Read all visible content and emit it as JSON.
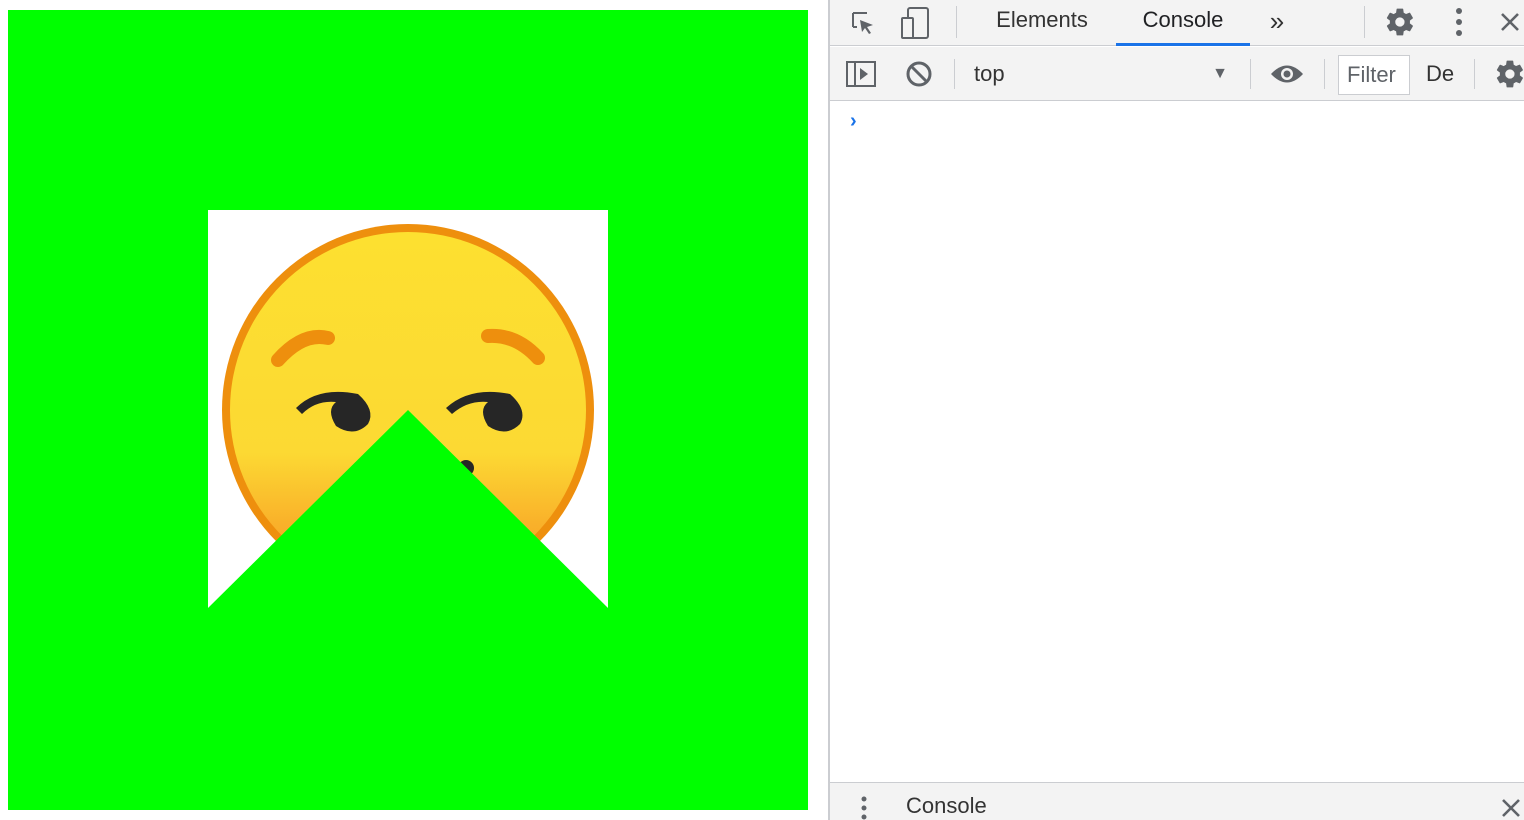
{
  "page": {
    "background_color": "#00ff00",
    "frame_color": "#ffffff",
    "emoji_icon": "smirking-face-icon"
  },
  "devtools": {
    "tabs": [
      {
        "label": "Elements",
        "selected": false
      },
      {
        "label": "Console",
        "selected": true
      }
    ],
    "more_tabs_icon": "double-chevron-right-icon",
    "toolbar": {
      "context": "top",
      "filter_placeholder": "Filter",
      "levels_label": "De"
    },
    "console": {
      "prompt": "›"
    },
    "drawer": {
      "tab_label": "Console"
    },
    "accent_color": "#1a73e8"
  }
}
